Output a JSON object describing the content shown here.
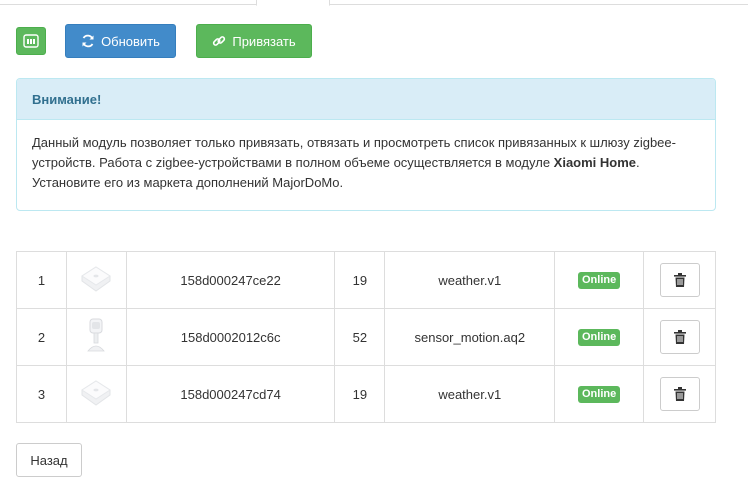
{
  "toolbar": {
    "refresh_label": "Обновить",
    "bind_label": "Привязать"
  },
  "alert": {
    "title": "Внимание!",
    "text_1": "Данный модуль позволяет только привязать, отвязать и просмотреть список привязанных к шлюзу zigbee-устройств. Работа с zigbee-устройствами в полном объеме осуществляется в модуле ",
    "text_bold": "Xiaomi Home",
    "text_2": ". Установите его из маркета дополнений MajorDoMo."
  },
  "devices": [
    {
      "num": "1",
      "image": "weather-sensor-icon",
      "mac": "158d000247ce22",
      "value": "19",
      "model": "weather.v1",
      "status": "Online"
    },
    {
      "num": "2",
      "image": "motion-sensor-icon",
      "mac": "158d0002012c6c",
      "value": "52",
      "model": "sensor_motion.aq2",
      "status": "Online"
    },
    {
      "num": "3",
      "image": "weather-sensor-icon",
      "mac": "158d000247cd74",
      "value": "19",
      "model": "weather.v1",
      "status": "Online"
    }
  ],
  "back_label": "Назад",
  "colors": {
    "success": "#5cb85c",
    "primary": "#428bca",
    "info_bg": "#d9edf7",
    "info_text": "#31708f"
  }
}
